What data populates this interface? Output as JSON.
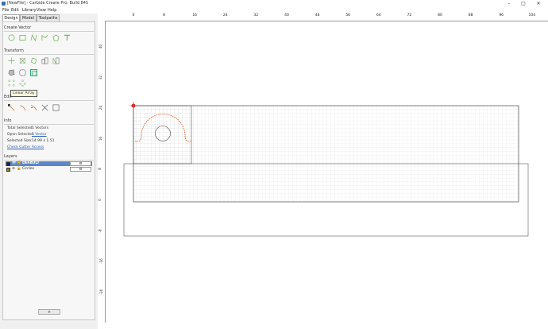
{
  "window": {
    "title": "[NewFile] - Carbide Create Pro, Build 845"
  },
  "menu": [
    "File",
    "Edit",
    "Library",
    "View",
    "Help"
  ],
  "tabs": [
    "Design",
    "Model",
    "Toolpaths"
  ],
  "panel": {
    "create_vector": "Create Vector",
    "transform": "Transform",
    "edit": "Edit",
    "info": "Info",
    "layers": "Layers",
    "tooltip": "Linear Array"
  },
  "info": {
    "total_selected_label": "Total Selected:",
    "total_selected_value": "1 Vectors",
    "open_selected_label": "Open Selected:",
    "open_selected_value": "1 Vector",
    "selected_size_label": "Selected Size:",
    "selected_size_value": "14.99 x 1.51",
    "check_cutter": "Check Cutter Access"
  },
  "layers": [
    {
      "name": "DEFAULT",
      "color": "#1a1a6e",
      "selected": true
    },
    {
      "name": "Circles",
      "color": "#8a8a2a",
      "selected": false
    }
  ],
  "add_layer_label": "+",
  "ruler": {
    "top": [
      "0",
      "8",
      "16",
      "24",
      "32",
      "40",
      "48",
      "56",
      "64",
      "72",
      "80",
      "88",
      "96",
      "104"
    ],
    "left": [
      "40",
      "32",
      "24",
      "16",
      "8",
      "0",
      "-8",
      "-16",
      "-24"
    ]
  },
  "colors": {
    "accent": "#5b87c7",
    "selection": "#e05a1a",
    "grid": "#d6d6d6"
  }
}
